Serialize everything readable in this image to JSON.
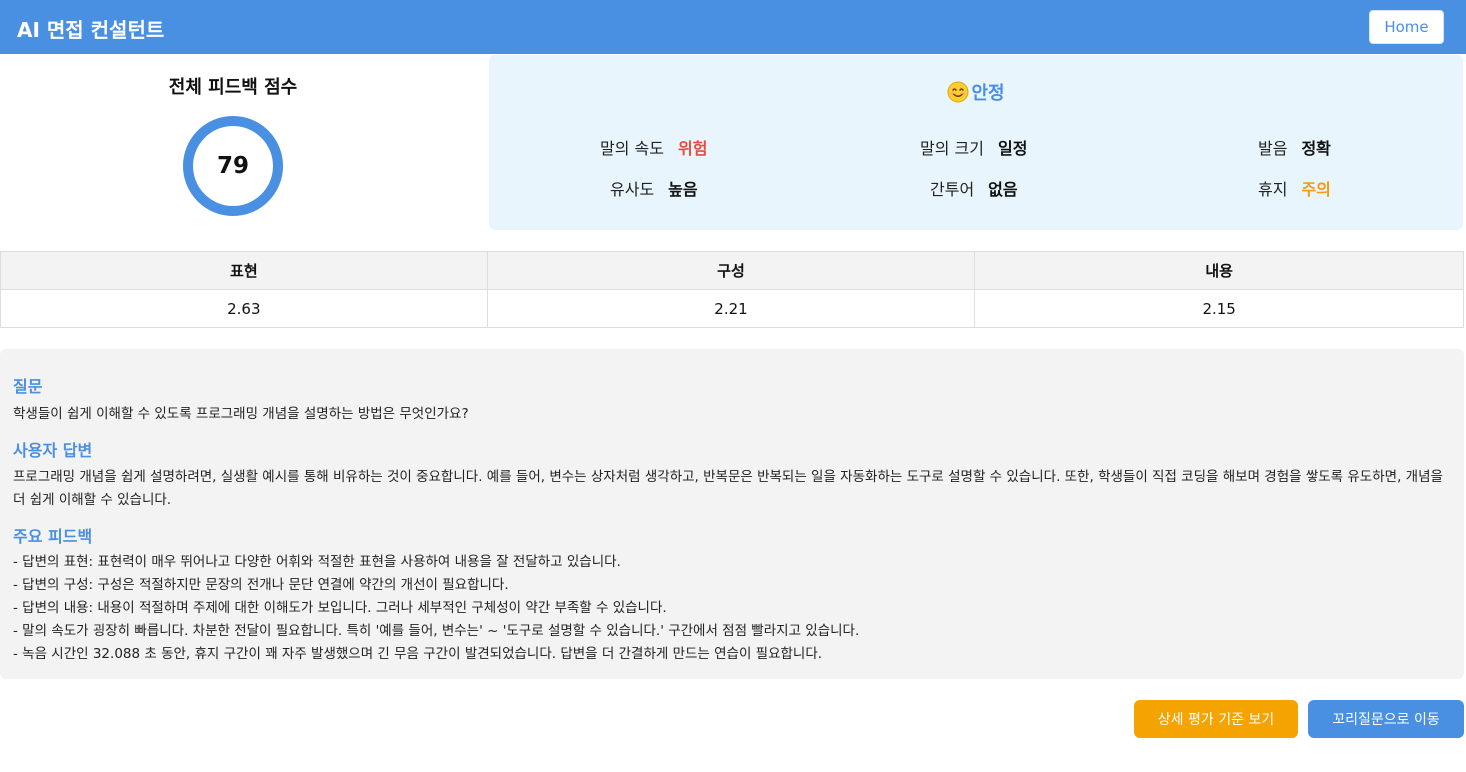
{
  "header": {
    "title": "AI 면접 컨설턴트",
    "home_label": "Home"
  },
  "score": {
    "title": "전체 피드백 점수",
    "value": "79",
    "percent": 79,
    "ring_color": "#4a90e2"
  },
  "emotion": {
    "icon": "smiling-face-emoji",
    "label": "안정"
  },
  "metrics": [
    {
      "label": "말의 속도",
      "value": "위험",
      "color": "#e74c3c"
    },
    {
      "label": "말의 크기",
      "value": "일정",
      "color": "#111111"
    },
    {
      "label": "발음",
      "value": "정확",
      "color": "#111111"
    },
    {
      "label": "유사도",
      "value": "높음",
      "color": "#111111"
    },
    {
      "label": "간투어",
      "value": "없음",
      "color": "#111111"
    },
    {
      "label": "휴지",
      "value": "주의",
      "color": "#f39c12"
    }
  ],
  "table": {
    "headers": [
      "표현",
      "구성",
      "내용"
    ],
    "values": [
      "2.63",
      "2.21",
      "2.15"
    ]
  },
  "question": {
    "heading": "질문",
    "text": "학생들이 쉽게 이해할 수 있도록 프로그래밍 개념을 설명하는 방법은 무엇인가요?"
  },
  "answer": {
    "heading": "사용자 답변",
    "text": "프로그래밍 개념을 쉽게 설명하려면, 실생활 예시를 통해 비유하는 것이 중요합니다. 예를 들어, 변수는 상자처럼 생각하고, 반복문은 반복되는 일을 자동화하는 도구로 설명할 수 있습니다. 또한, 학생들이 직접 코딩을 해보며 경험을 쌓도록 유도하면, 개념을 더 쉽게 이해할 수 있습니다."
  },
  "feedback": {
    "heading": "주요 피드백",
    "items": [
      "- 답변의 표현: 표현력이 매우 뛰어나고 다양한 어휘와 적절한 표현을 사용하여 내용을 잘 전달하고 있습니다.",
      "- 답변의 구성: 구성은 적절하지만 문장의 전개나 문단 연결에 약간의 개선이 필요합니다.",
      "- 답변의 내용: 내용이 적절하며 주제에 대한 이해도가 보입니다. 그러나 세부적인 구체성이 약간 부족할 수 있습니다.",
      "- 말의 속도가 굉장히 빠릅니다. 차분한 전달이 필요합니다. 특히 '예를 들어, 변수는' ~ '도구로 설명할 수 있습니다.' 구간에서 점점 빨라지고 있습니다.",
      "- 녹음 시간인 32.088 초 동안, 휴지 구간이 꽤 자주 발생했으며 긴 무음 구간이 발견되었습니다. 답변을 더 간결하게 만드는 연습이 필요합니다."
    ]
  },
  "buttons": {
    "criteria_label": "상세 평가 기준 보기",
    "followup_label": "꼬리질문으로 이동"
  }
}
